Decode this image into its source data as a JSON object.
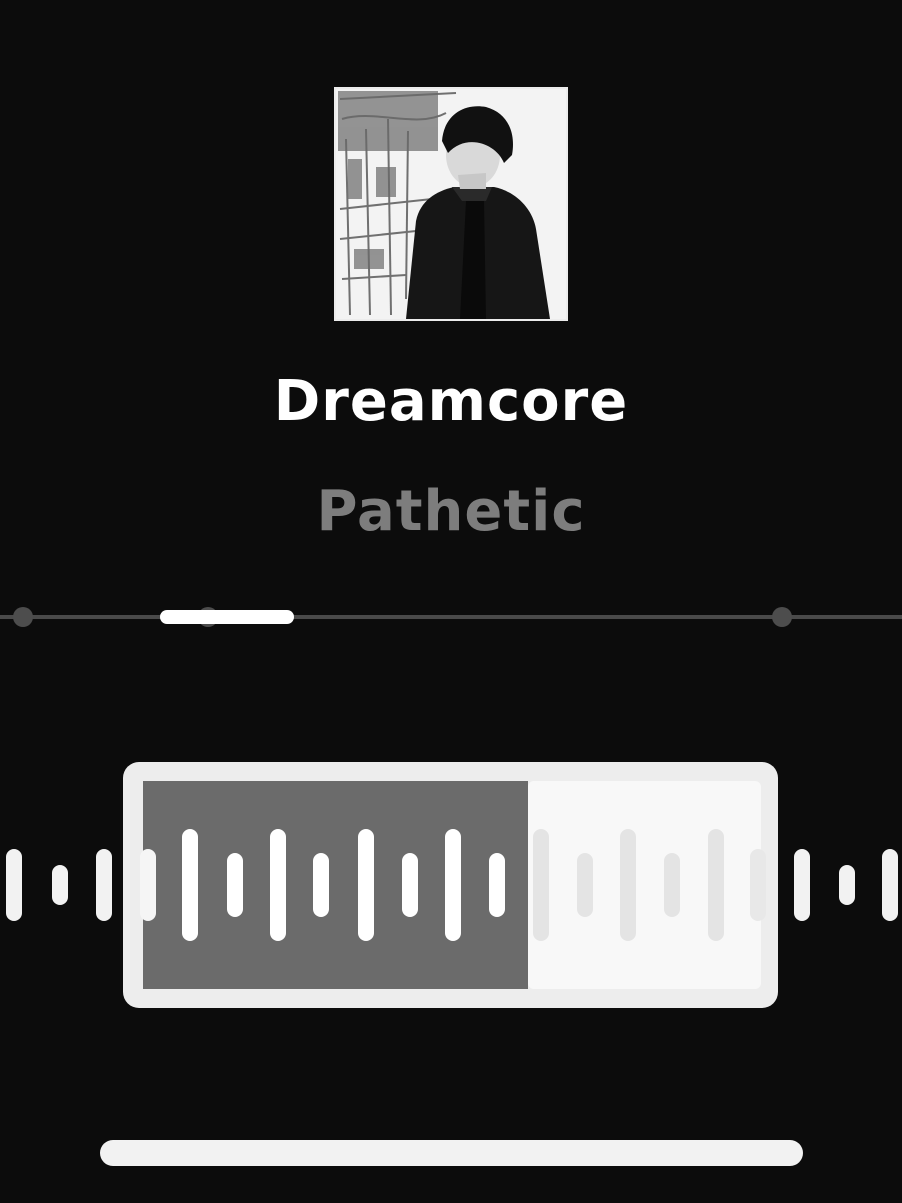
{
  "track": {
    "title": "Dreamcore",
    "artist": "Pathetic"
  },
  "cover_art": {
    "icon": "album-cover-portrait",
    "style": "black-and-white photo"
  },
  "progress": {
    "fraction": 0.23
  },
  "waveform": {
    "icon": "audio-waveform",
    "played_fraction": 0.59,
    "colors": {
      "frame": "#ededed",
      "played_bg": "#6b6b6b",
      "unplayed_bg": "#f8f8f8",
      "bar": "#ffffff"
    }
  },
  "colors": {
    "background": "#0c0c0c",
    "title": "#ffffff",
    "artist": "#7d7d7d"
  }
}
